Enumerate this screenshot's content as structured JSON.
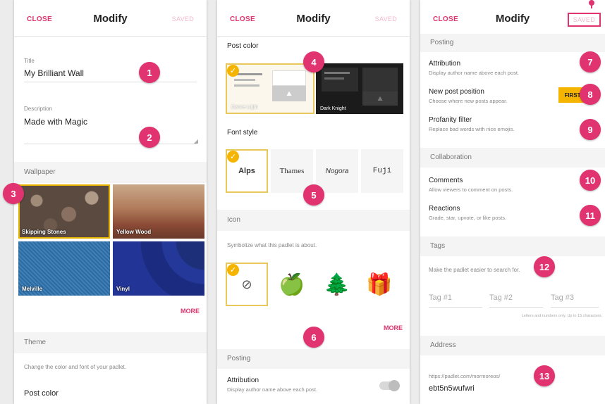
{
  "header": {
    "close": "CLOSE",
    "title": "Modify",
    "saved": "SAVED"
  },
  "panel1": {
    "title_label": "Title",
    "title_value": "My Brilliant Wall",
    "desc_label": "Description",
    "desc_value": "Made with Magic",
    "wallpaper_section": "Wallpaper",
    "wallpapers": [
      "Skipping Stones",
      "Yellow Wood",
      "Melville",
      "Vinyl"
    ],
    "more": "MORE",
    "theme_section": "Theme",
    "theme_desc": "Change the color and font of your padlet.",
    "post_color": "Post color"
  },
  "panel2": {
    "post_color": "Post color",
    "colors": [
      "Dance Light",
      "Dark Knight"
    ],
    "font_style": "Font style",
    "fonts": [
      "Alps",
      "Thames",
      "Nogora",
      "Fuji"
    ],
    "icon_section": "Icon",
    "icon_desc": "Symbolize what this padlet is about.",
    "icons": [
      "⊘",
      "🍏",
      "🌲",
      "🎁"
    ],
    "more": "MORE",
    "posting_section": "Posting",
    "attribution": "Attribution",
    "attribution_desc": "Display author name above each post."
  },
  "panel3": {
    "posting_section": "Posting",
    "attribution": "Attribution",
    "attribution_desc": "Display author name above each post.",
    "new_post": "New post position",
    "new_post_desc": "Choose where new posts appear.",
    "new_post_value": "FIRST",
    "profanity": "Profanity filter",
    "profanity_desc": "Replace bad words with nice emojis.",
    "collab_section": "Collaboration",
    "comments": "Comments",
    "comments_desc": "Allow viewers to comment on posts.",
    "reactions": "Reactions",
    "reactions_desc": "Grade, star, upvote, or like posts.",
    "tags_section": "Tags",
    "tags_desc": "Make the padlet easier to search for.",
    "tags": [
      "Tag #1",
      "Tag #2",
      "Tag #3"
    ],
    "tags_hint": "Letters and numbers only. Up to 15 characters.",
    "address_section": "Address",
    "address_prefix": "https://padlet.com/mormoreos/",
    "address_value": "ebt5n5wufwri"
  },
  "badges": [
    "1",
    "2",
    "3",
    "4",
    "5",
    "6",
    "7",
    "8",
    "9",
    "10",
    "11",
    "12",
    "13"
  ],
  "colors": {
    "accent": "#e0336f",
    "selection": "#f5b400"
  }
}
